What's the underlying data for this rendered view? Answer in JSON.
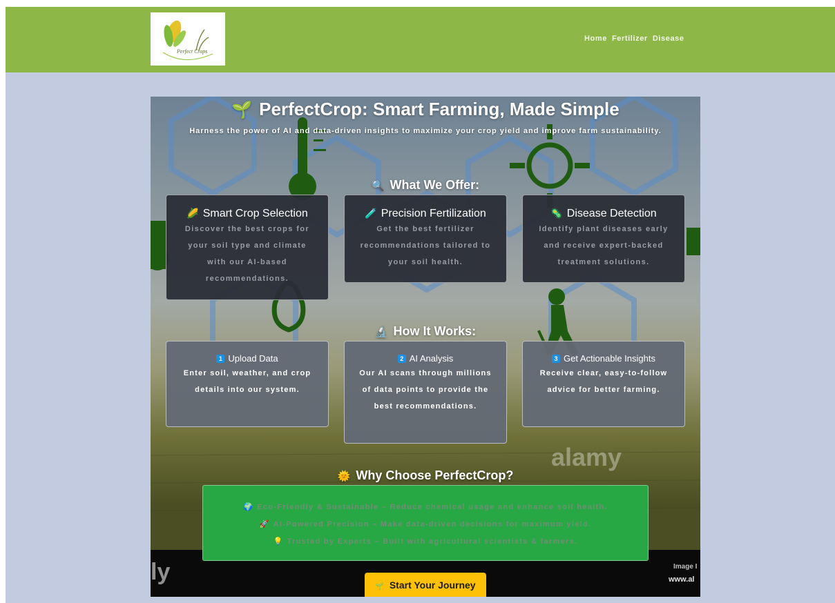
{
  "nav": {
    "logo_text": "Perfect Crops",
    "links": [
      "Home",
      "Fertilizer",
      "Disease"
    ]
  },
  "hero": {
    "title": "PerfectCrop: Smart Farming, Made Simple",
    "subtitle": "Harness the power of AI and data-driven insights to maximize your crop yield and improve farm sustainability."
  },
  "offer": {
    "heading": "What We Offer:",
    "cards": [
      {
        "title": "Smart Crop Selection",
        "body": "Discover the best crops for your soil type and climate with our AI-based recommendations."
      },
      {
        "title": "Precision Fertilization",
        "body": "Get the best fertilizer recommendations tailored to your soil health."
      },
      {
        "title": "Disease Detection",
        "body": "Identify plant diseases early and receive expert-backed treatment solutions."
      }
    ]
  },
  "how": {
    "heading": "How It Works:",
    "steps": [
      {
        "num": "1",
        "title": "Upload Data",
        "body": "Enter soil, weather, and crop details into our system."
      },
      {
        "num": "2",
        "title": "AI Analysis",
        "body": "Our AI scans through millions of data points to provide the best recommendations."
      },
      {
        "num": "3",
        "title": "Get Actionable Insights",
        "body": "Receive clear, easy-to-follow advice for better farming."
      }
    ]
  },
  "why": {
    "heading": "Why Choose PerfectCrop?",
    "points": [
      "Eco-Friendly & Sustainable – Reduce chemical usage and enhance soil health.",
      "AI-Powered Precision – Make data-driven decisions for maximum yield.",
      "Trusted by Experts – Built with agricultural scientists & farmers."
    ]
  },
  "watermark": {
    "brand": "alamy",
    "corner_line1": "Image I",
    "corner_line2": "www.al",
    "left_corner": "ly"
  },
  "cta": {
    "label": "Start Your Journey"
  },
  "colors": {
    "navbar": "#8db747",
    "page_background": "#c2cbe0",
    "offer_card": "#2a2d36",
    "step_card": "#646a75",
    "why_box": "#28a745",
    "cta_button": "#ffc107"
  }
}
